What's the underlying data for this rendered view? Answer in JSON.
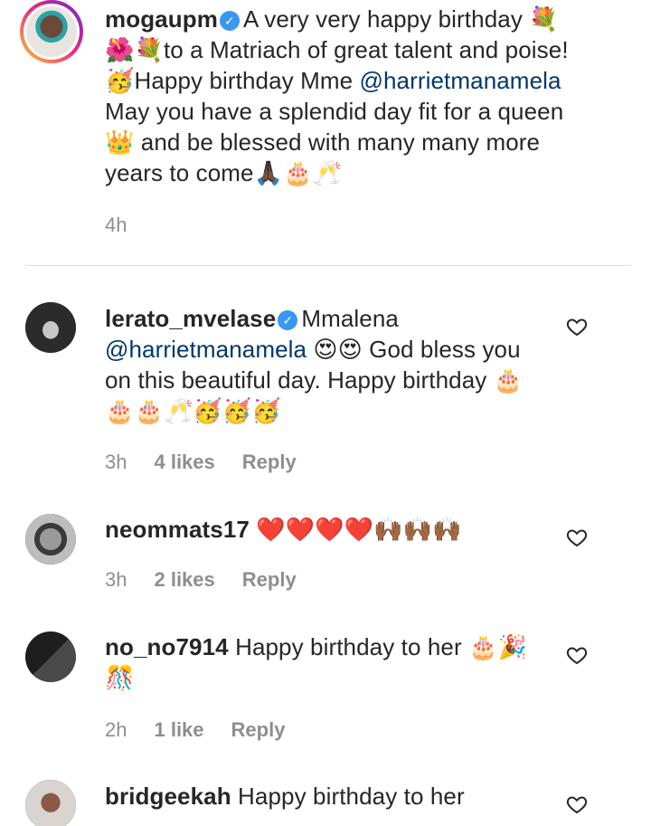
{
  "comments": [
    {
      "username": "mogaupm",
      "verified": true,
      "body_lines": [
        "A very very happy birthday 💐",
        "🌺💐to a Matriach of great talent and poise!",
        "🥳Happy birthday Mme @harrietmanamela",
        "May you have a splendid day fit for a queen",
        "👑 and be blessed with many many more",
        "years to come🙏🏿🎂🥂"
      ],
      "mention": "@harrietmanamela",
      "time": "4h",
      "likes": "",
      "reply": ""
    },
    {
      "username": "lerato_mvelase",
      "verified": true,
      "line1_rest": "Mmalena",
      "mention": "@harrietmanamela",
      "line2_rest": "😍😍 God bless you",
      "line3": "on this beautiful day. Happy birthday 🎂",
      "line4": "🎂🎂🥂🥳🥳🥳",
      "time": "3h",
      "likes": "4 likes",
      "reply": "Reply"
    },
    {
      "username": "neommats17",
      "verified": false,
      "text": "❤️❤️❤️❤️🙌🏾🙌🏾🙌🏾",
      "time": "3h",
      "likes": "2 likes",
      "reply": "Reply"
    },
    {
      "username": "no_no7914",
      "verified": false,
      "text": "Happy birthday to her 🎂🎉",
      "line2": "🎊",
      "time": "2h",
      "likes": "1 like",
      "reply": "Reply"
    },
    {
      "username": "bridgeekah",
      "verified": false,
      "text": "Happy birthday to her"
    }
  ],
  "icons": {
    "heart": "heart-outline-icon",
    "verified": "verified-badge-icon"
  },
  "colors": {
    "text": "#262626",
    "meta": "#8e8e8e",
    "mention": "#00376b",
    "verified": "#3897f0",
    "divider": "#dbdbdb"
  }
}
